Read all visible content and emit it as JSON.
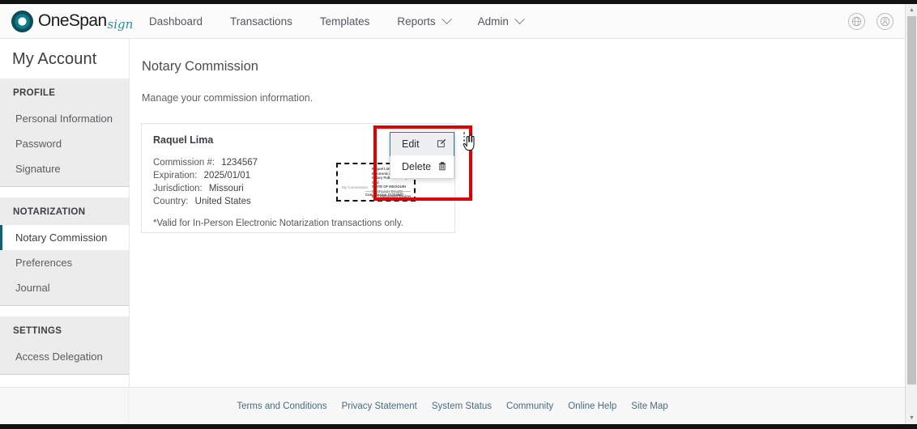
{
  "brand": {
    "name": "OneSpan",
    "suffix": "sign",
    "accent_color": "#0b6570",
    "logo_icon": "onespan-ring-logo"
  },
  "topnav": {
    "items": [
      {
        "label": "Dashboard",
        "has_caret": false
      },
      {
        "label": "Transactions",
        "has_caret": false
      },
      {
        "label": "Templates",
        "has_caret": false
      },
      {
        "label": "Reports",
        "has_caret": true
      },
      {
        "label": "Admin",
        "has_caret": true
      }
    ],
    "right_icons": [
      {
        "name": "globe-icon",
        "glyph": "♁"
      },
      {
        "name": "user-account-icon",
        "glyph": "⚲"
      }
    ]
  },
  "sidebar": {
    "title": "My Account",
    "groups": [
      {
        "heading": "PROFILE",
        "items": [
          {
            "label": "Personal Information",
            "active": false
          },
          {
            "label": "Password",
            "active": false
          },
          {
            "label": "Signature",
            "active": false
          }
        ]
      },
      {
        "heading": "NOTARIZATION",
        "items": [
          {
            "label": "Notary Commission",
            "active": true
          },
          {
            "label": "Preferences",
            "active": false
          },
          {
            "label": "Journal",
            "active": false
          }
        ]
      },
      {
        "heading": "SETTINGS",
        "items": [
          {
            "label": "Access Delegation",
            "active": false
          }
        ]
      }
    ]
  },
  "main": {
    "title": "Notary Commission",
    "subtitle": "Manage your commission information.",
    "card": {
      "name": "Raquel Lima",
      "fields": [
        {
          "key": "Commission #:",
          "value": "1234567"
        },
        {
          "key": "Expiration:",
          "value": "2025/01/01"
        },
        {
          "key": "Jurisdiction:",
          "value": "Missouri"
        },
        {
          "key": "Country:",
          "value": "United States"
        }
      ],
      "note": "*Valid for In-Person Electronic Notarization transactions only.",
      "seal": {
        "left_text": "My Commission",
        "lines": [
          "Raquel Lima",
          "Electronic Notary Public",
          "Notary Public - Notary Seal",
          "STATE OF MISSOURI",
          "Saint Louis County",
          "My Commission Expires"
        ],
        "bottom_text": "Commission #1234567"
      },
      "kebab_menu_icon": "kebab-menu-icon",
      "menu": {
        "items": [
          {
            "label": "Edit",
            "icon": "edit-pencil-icon",
            "glyph": "✎",
            "hovered": true
          },
          {
            "label": "Delete",
            "icon": "trash-can-icon",
            "glyph": "🗑",
            "hovered": false
          }
        ]
      }
    }
  },
  "footer": {
    "links": [
      "Terms and Conditions",
      "Privacy Statement",
      "System Status",
      "Community",
      "Online Help",
      "Site Map"
    ]
  },
  "annotation": {
    "type": "highlight-rectangle",
    "color": "#e00000"
  }
}
